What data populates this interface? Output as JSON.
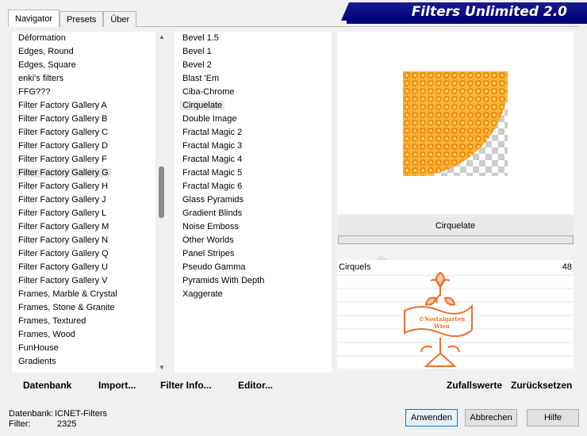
{
  "tabs": [
    "Navigator",
    "Presets",
    "Über"
  ],
  "banner_title": "Filters Unlimited 2.0",
  "categories": [
    "Déformation",
    "Edges, Round",
    "Edges, Square",
    "enki's filters",
    "FFG???",
    "Filter Factory Gallery A",
    "Filter Factory Gallery B",
    "Filter Factory Gallery C",
    "Filter Factory Gallery D",
    "Filter Factory Gallery F",
    "Filter Factory Gallery G",
    "Filter Factory Gallery H",
    "Filter Factory Gallery J",
    "Filter Factory Gallery L",
    "Filter Factory Gallery M",
    "Filter Factory Gallery N",
    "Filter Factory Gallery Q",
    "Filter Factory Gallery U",
    "Filter Factory Gallery V",
    "Frames, Marble & Crystal",
    "Frames, Stone & Granite",
    "Frames, Textured",
    "Frames, Wood",
    "FunHouse",
    "Gradients"
  ],
  "selected_category": "Filter Factory Gallery G",
  "filters": [
    "Bevel 1.5",
    "Bevel 1",
    "Bevel 2",
    "Blast 'Em",
    "Ciba-Chrome",
    "Cirquelate",
    "Double Image",
    "Fractal Magic 2",
    "Fractal Magic 3",
    "Fractal Magic 4",
    "Fractal Magic 5",
    "Fractal Magic 6",
    "Glass Pyramids",
    "Gradient Blinds",
    "Noise Emboss",
    "Other Worlds",
    "Panel Stripes",
    "Pseudo Gamma",
    "Pyramids With Depth",
    "Xaggerate"
  ],
  "selected_filter": "Cirquelate",
  "preview": {
    "filter_name": "Cirquelate",
    "colors": {
      "background": "#f1b92d",
      "ring_outer": "#f58220",
      "ring_inner": "#ffd24a"
    }
  },
  "controls": [
    {
      "label": "Cirquels",
      "value": "48"
    }
  ],
  "watermark_text": [
    "©Nostalgarten",
    "Wien"
  ],
  "left_buttons": [
    "Datenbank",
    "Import...",
    "Filter Info...",
    "Editor..."
  ],
  "right_buttons": [
    "Zufallswerte",
    "Zurücksetzen"
  ],
  "status": {
    "database_label": "Datenbank:",
    "database_value": "ICNET-Filters",
    "filter_label": "Filter:",
    "filter_value": "2325"
  },
  "dialog_buttons": {
    "apply": "Anwenden",
    "cancel": "Abbrechen",
    "help": "Hilfe"
  }
}
